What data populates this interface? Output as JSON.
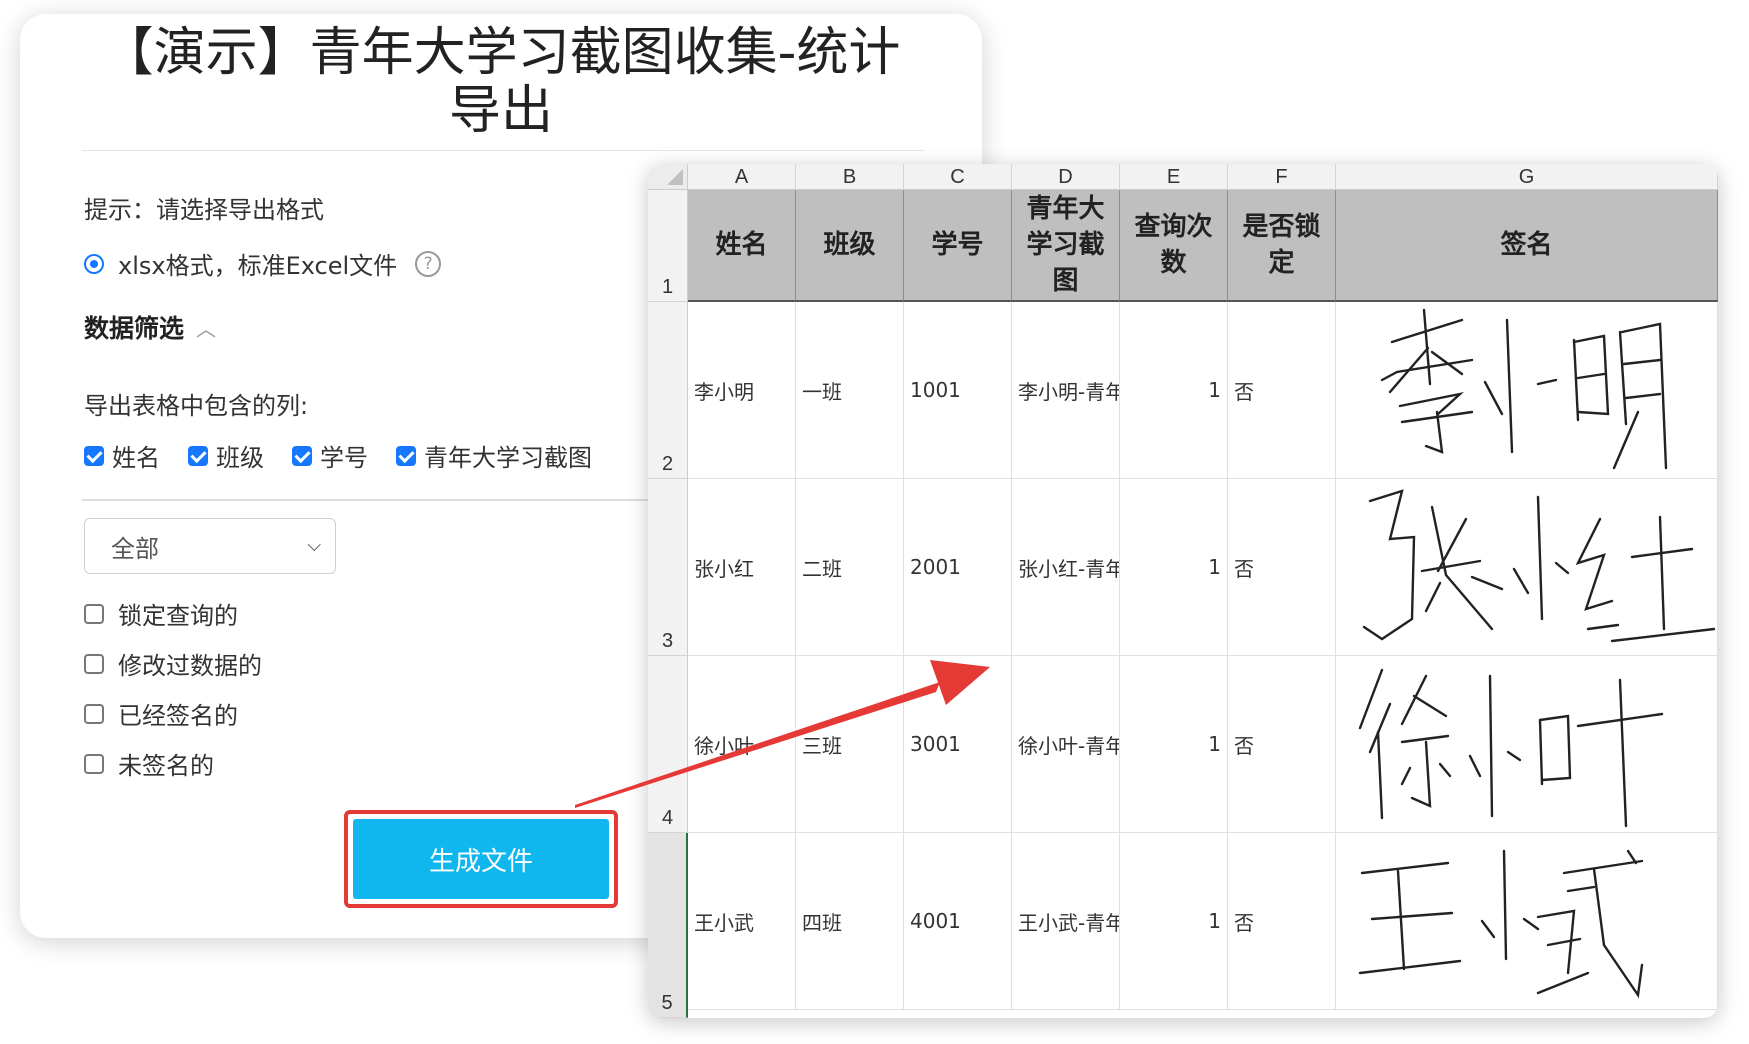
{
  "dialog": {
    "title": "【演示】青年大学习截图收集-统计导出",
    "hint": "提示：请选择导出格式",
    "format_option": "xlsx格式，标准Excel文件",
    "help_icon": "?",
    "section_title": "数据筛选",
    "columns_label": "导出表格中包含的列:",
    "columns": [
      {
        "label": "姓名",
        "checked": true
      },
      {
        "label": "班级",
        "checked": true
      },
      {
        "label": "学号",
        "checked": true
      },
      {
        "label": "青年大学习截图",
        "checked": true
      }
    ],
    "select_value": "全部",
    "filters": [
      {
        "label": "锁定查询的",
        "checked": false
      },
      {
        "label": "修改过数据的",
        "checked": false
      },
      {
        "label": "已经签名的",
        "checked": false
      },
      {
        "label": "未签名的",
        "checked": false
      }
    ],
    "generate_button": "生成文件",
    "accent_color": "#1677ff",
    "button_color": "#0fb7ee",
    "highlight_color": "#e53935"
  },
  "sheet": {
    "column_letters": [
      "A",
      "B",
      "C",
      "D",
      "E",
      "F",
      "G"
    ],
    "row_numbers": [
      "1",
      "2",
      "3",
      "4",
      "5"
    ],
    "headers": [
      "姓名",
      "班级",
      "学号",
      "青年大学习截图",
      "查询次数",
      "是否锁定",
      "签名"
    ],
    "rows": [
      {
        "name": "李小明",
        "class": "一班",
        "id": "1001",
        "screenshot": "李小明-青年",
        "count": "1",
        "locked": "否",
        "signature": "李小明"
      },
      {
        "name": "张小红",
        "class": "二班",
        "id": "2001",
        "screenshot": "张小红-青年",
        "count": "1",
        "locked": "否",
        "signature": "张小红"
      },
      {
        "name": "徐小叶",
        "class": "三班",
        "id": "3001",
        "screenshot": "徐小叶-青年",
        "count": "1",
        "locked": "否",
        "signature": "徐小叶"
      },
      {
        "name": "王小武",
        "class": "四班",
        "id": "4001",
        "screenshot": "王小武-青年",
        "count": "1",
        "locked": "否",
        "signature": "王小武"
      }
    ],
    "header_fill": "#bfbfbf"
  },
  "arrow": {
    "color": "#e53935",
    "icon": "arrow-right-icon"
  }
}
